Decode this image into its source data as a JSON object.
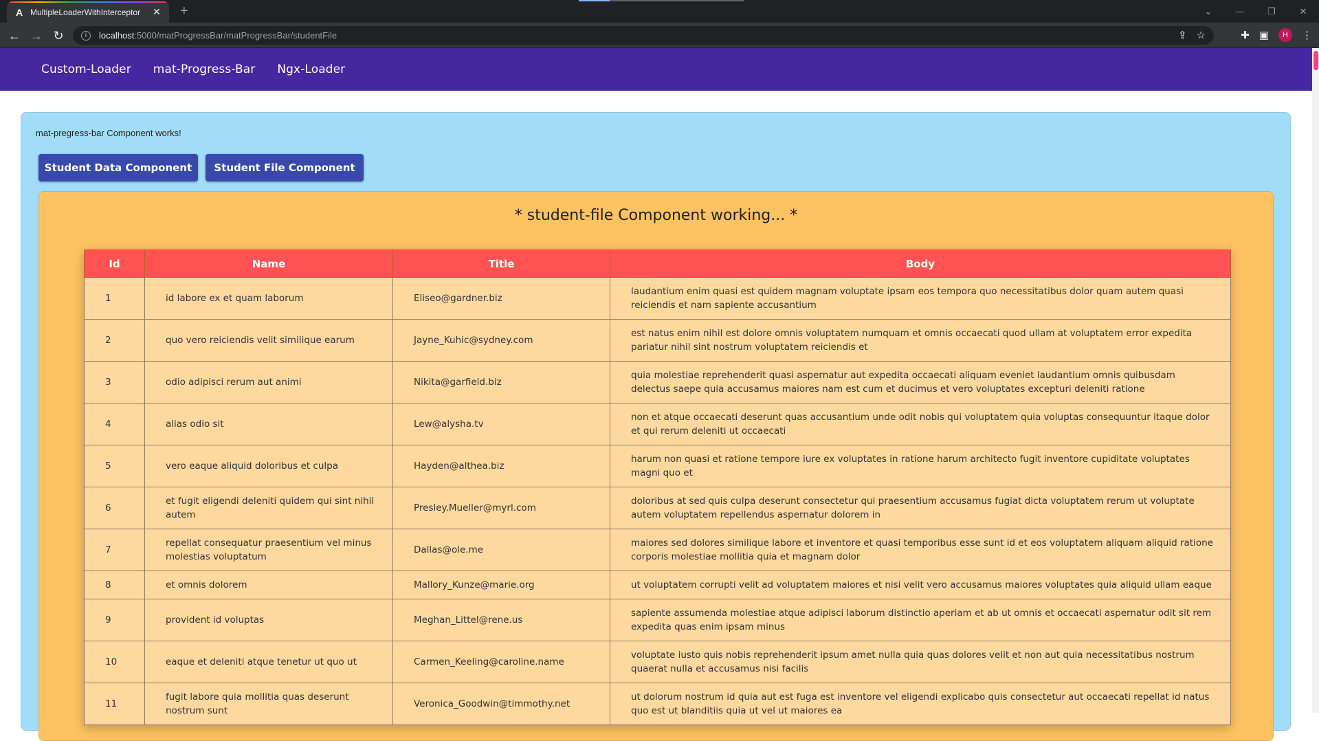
{
  "browser": {
    "tab_title": "MultipleLoaderWithInterceptor",
    "url_host": "localhost",
    "url_rest": ":5000/matProgressBar/matProgressBar/studentFile",
    "avatar_letter": "H",
    "favicon_letter": "A"
  },
  "nav": {
    "items": [
      "Custom-Loader",
      "mat-Progress-Bar",
      "Ngx-Loader"
    ]
  },
  "page": {
    "works_text": "mat-pregress-bar Component works!",
    "buttons": [
      "Student Data Component",
      "Student File Component"
    ],
    "heading": "* student-file Component working... *"
  },
  "table": {
    "headers": [
      "Id",
      "Name",
      "Title",
      "Body"
    ],
    "rows": [
      {
        "id": "1",
        "name": "id labore ex et quam laborum",
        "title": "Eliseo@gardner.biz",
        "body": "laudantium enim quasi est quidem magnam voluptate ipsam eos tempora quo necessitatibus dolor quam autem quasi reiciendis et nam sapiente accusantium"
      },
      {
        "id": "2",
        "name": "quo vero reiciendis velit similique earum",
        "title": "Jayne_Kuhic@sydney.com",
        "body": "est natus enim nihil est dolore omnis voluptatem numquam et omnis occaecati quod ullam at voluptatem error expedita pariatur nihil sint nostrum voluptatem reiciendis et"
      },
      {
        "id": "3",
        "name": "odio adipisci rerum aut animi",
        "title": "Nikita@garfield.biz",
        "body": "quia molestiae reprehenderit quasi aspernatur aut expedita occaecati aliquam eveniet laudantium omnis quibusdam delectus saepe quia accusamus maiores nam est cum et ducimus et vero voluptates excepturi deleniti ratione"
      },
      {
        "id": "4",
        "name": "alias odio sit",
        "title": "Lew@alysha.tv",
        "body": "non et atque occaecati deserunt quas accusantium unde odit nobis qui voluptatem quia voluptas consequuntur itaque dolor et qui rerum deleniti ut occaecati"
      },
      {
        "id": "5",
        "name": "vero eaque aliquid doloribus et culpa",
        "title": "Hayden@althea.biz",
        "body": "harum non quasi et ratione tempore iure ex voluptates in ratione harum architecto fugit inventore cupiditate voluptates magni quo et"
      },
      {
        "id": "6",
        "name": "et fugit eligendi deleniti quidem qui sint nihil autem",
        "title": "Presley.Mueller@myrl.com",
        "body": "doloribus at sed quis culpa deserunt consectetur qui praesentium accusamus fugiat dicta voluptatem rerum ut voluptate autem voluptatem repellendus aspernatur dolorem in"
      },
      {
        "id": "7",
        "name": "repellat consequatur praesentium vel minus molestias voluptatum",
        "title": "Dallas@ole.me",
        "body": "maiores sed dolores similique labore et inventore et quasi temporibus esse sunt id et eos voluptatem aliquam aliquid ratione corporis molestiae mollitia quia et magnam dolor"
      },
      {
        "id": "8",
        "name": "et omnis dolorem",
        "title": "Mallory_Kunze@marie.org",
        "body": "ut voluptatem corrupti velit ad voluptatem maiores et nisi velit vero accusamus maiores voluptates quia aliquid ullam eaque"
      },
      {
        "id": "9",
        "name": "provident id voluptas",
        "title": "Meghan_Littel@rene.us",
        "body": "sapiente assumenda molestiae atque adipisci laborum distinctio aperiam et ab ut omnis et occaecati aspernatur odit sit rem expedita quas enim ipsam minus"
      },
      {
        "id": "10",
        "name": "eaque et deleniti atque tenetur ut quo ut",
        "title": "Carmen_Keeling@caroline.name",
        "body": "voluptate iusto quis nobis reprehenderit ipsum amet nulla quia quas dolores velit et non aut quia necessitatibus nostrum quaerat nulla et accusamus nisi facilis"
      },
      {
        "id": "11",
        "name": "fugit labore quia mollitia quas deserunt nostrum sunt",
        "title": "Veronica_Goodwin@timmothy.net",
        "body": "ut dolorum nostrum id quia aut est fuga est inventore vel eligendi explicabo quis consectetur aut occaecati repellat id natus quo est ut blanditiis quia ut vel ut maiores ea"
      }
    ]
  }
}
